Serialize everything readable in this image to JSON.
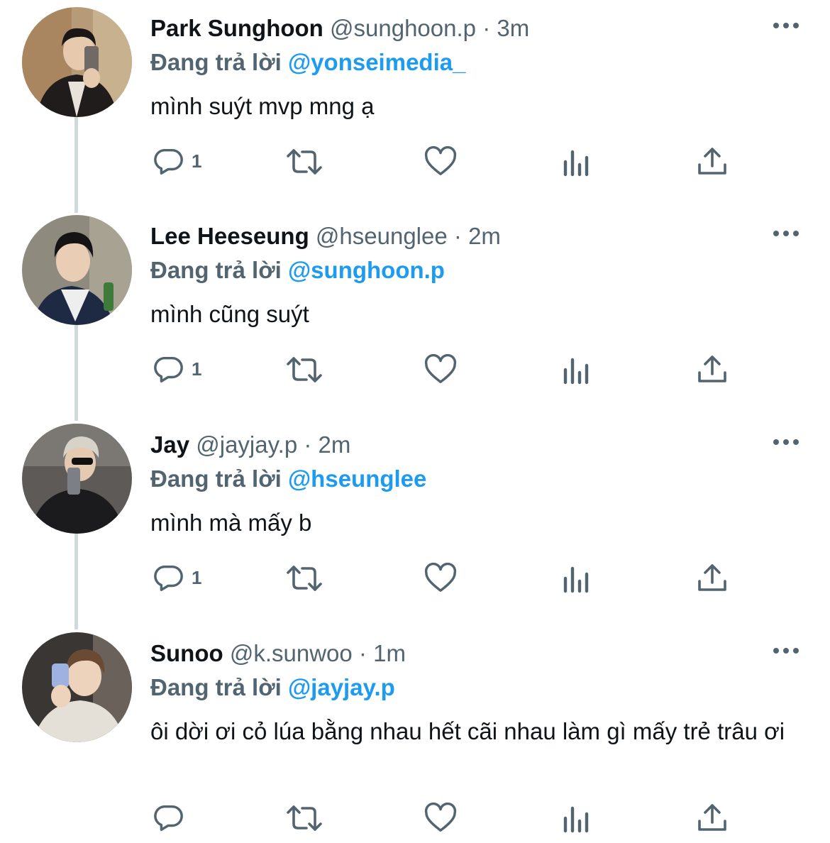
{
  "labels": {
    "replying_to": "Đang trả lời",
    "separator": "·"
  },
  "colors": {
    "accent": "#1d9bf0",
    "muted": "#536471",
    "text": "#0f1419",
    "thread_line": "#cfd9de"
  },
  "icons": [
    "more-icon",
    "reply-icon",
    "retweet-icon",
    "like-icon",
    "views-icon",
    "share-icon"
  ],
  "tweets": [
    {
      "name": "Park Sunghoon",
      "handle": "@sunghoon.p",
      "time": "3m",
      "reply_to": "@yonseimedia_",
      "text": "mình suýt mvp mng ạ",
      "reply_count": "1"
    },
    {
      "name": "Lee Heeseung",
      "handle": "@hseunglee",
      "time": "2m",
      "reply_to": "@sunghoon.p",
      "text": "mình cũng suýt",
      "reply_count": "1"
    },
    {
      "name": "Jay",
      "handle": "@jayjay.p",
      "time": "2m",
      "reply_to": "@hseunglee",
      "text": "mình mà mấy b",
      "reply_count": "1"
    },
    {
      "name": "Sunoo",
      "handle": "@k.sunwoo",
      "time": "1m",
      "reply_to": "@jayjay.p",
      "text": "ôi dời ơi cỏ lúa bằng nhau hết cãi nhau làm gì mấy trẻ trâu ơi",
      "reply_count": ""
    }
  ]
}
